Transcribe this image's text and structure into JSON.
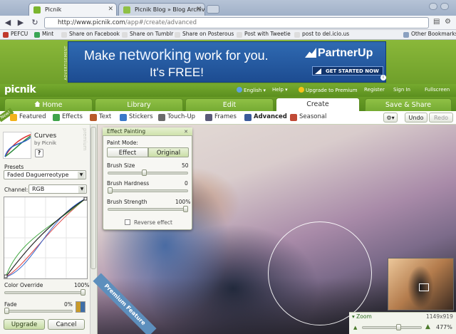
{
  "browser": {
    "tabs": [
      {
        "title": "Picnik",
        "active": true
      },
      {
        "title": "Picnik Blog » Blog Archive »",
        "active": false
      }
    ],
    "url": {
      "host": "http://www.picnik.com",
      "path": "/app#/create/advanced"
    },
    "bookmarks": [
      "PEFCU",
      "Mint",
      "Share on Facebook",
      "Share on Tumblr",
      "Share on Posterous",
      "Post with Tweetie",
      "post to del.icio.us"
    ],
    "other_bookmarks": "Other Bookmarks"
  },
  "ad": {
    "label": "ADVERTISEMENT",
    "line1_a": "Make ",
    "line1_b": "networking",
    "line1_c": " work for you.",
    "line2": "It's FREE!",
    "brand": "PartnerUp",
    "cta": "GET STARTED NOW"
  },
  "picnik": {
    "logo": "picnik",
    "header_links": {
      "language": "English ▾",
      "help": "Help ▾",
      "upgrade": "Upgrade to Premium",
      "register": "Register",
      "signin": "Sign In",
      "fullscreen": "Fullscreen"
    },
    "tabs": [
      {
        "label": "Home"
      },
      {
        "label": "Library"
      },
      {
        "label": "Edit"
      },
      {
        "label": "Create",
        "active": true
      },
      {
        "label": "Save & Share"
      }
    ],
    "new_flag": "New!",
    "subtabs": [
      {
        "label": "Featured",
        "color": "#f2b21a"
      },
      {
        "label": "Effects",
        "color": "#3fa34a"
      },
      {
        "label": "Text",
        "color": "#b85a2a"
      },
      {
        "label": "Stickers",
        "color": "#3a78c9"
      },
      {
        "label": "Touch-Up",
        "color": "#6b6b6b"
      },
      {
        "label": "Frames",
        "color": "#5a5a78"
      },
      {
        "label": "Advanced",
        "color": "#3a5a9a",
        "active": true
      },
      {
        "label": "Seasonal",
        "color": "#c04a36"
      }
    ],
    "undo": "Undo",
    "redo": "Redo",
    "settings_icon": "gear-icon"
  },
  "panel": {
    "effect_name": "Curves",
    "effect_by": "by Picnik",
    "help": "?",
    "premium_label": "premium",
    "presets_label": "Presets",
    "preset_value": "Faded Daguerreotype",
    "channel_label": "Channel:",
    "channel_value": "RGB",
    "color_override_label": "Color Override",
    "color_override_value": "100%",
    "color_override_fraction": 1.0,
    "fade_label": "Fade",
    "fade_value": "0%",
    "fade_fraction": 0.0,
    "upgrade": "Upgrade",
    "cancel": "Cancel"
  },
  "popup": {
    "title": "Effect Painting",
    "paint_mode_label": "Paint Mode:",
    "effect": "Effect",
    "original": "Original",
    "brush_size_label": "Brush Size",
    "brush_size_value": "50",
    "brush_size_fraction": 0.45,
    "brush_hardness_label": "Brush Hardness",
    "brush_hardness_value": "0",
    "brush_hardness_fraction": 0.0,
    "brush_strength_label": "Brush Strength",
    "brush_strength_value": "100%",
    "brush_strength_fraction": 1.0,
    "reverse_label": "Reverse effect"
  },
  "canvas": {
    "premium_band": "Premium Feature"
  },
  "zoom": {
    "label": "Zoom",
    "dimensions": "1149x919",
    "percent": "477%",
    "fraction": 0.62
  }
}
